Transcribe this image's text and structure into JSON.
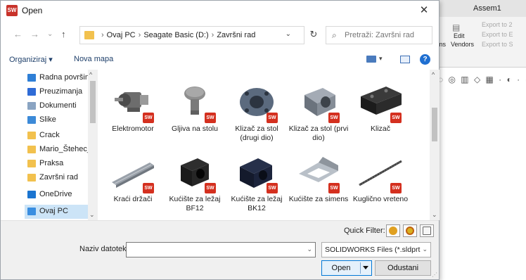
{
  "background_app": {
    "window_title": "Assem1",
    "ribbon": {
      "export_1": "Export to 2",
      "export_2": "Export to E",
      "export_3": "Export to S",
      "edit_label": "Edit",
      "vendors_label": "Vendors",
      "tions_label": "tions",
      "t_label": "t"
    }
  },
  "dialog": {
    "title": "Open",
    "close_glyph": "✕",
    "nav": {
      "back": "←",
      "forward": "→",
      "recent": "⌄",
      "up": "↑"
    },
    "breadcrumb": [
      "Ovaj PC",
      "Seagate Basic (D:)",
      "Završni rad"
    ],
    "breadcrumb_sep": "›",
    "refresh_glyph": "↻",
    "search_placeholder": "Pretraži: Završni rad",
    "toolbar": {
      "organize": "Organiziraj ▾",
      "new_folder": "Nova mapa",
      "help": "?"
    },
    "nav_pane": [
      {
        "label": "Radna površina",
        "pinned": true,
        "color": "#2f7fd6"
      },
      {
        "label": "Preuzimanja",
        "pinned": true,
        "color": "#2f6bd6"
      },
      {
        "label": "Dokumenti",
        "pinned": true,
        "color": "#8aa4c2"
      },
      {
        "label": "Slike",
        "pinned": true,
        "color": "#3c8ad8"
      },
      {
        "label": "Crack",
        "pinned": false,
        "color": "#f2c14e"
      },
      {
        "label": "Mario_Štehec_Al",
        "pinned": false,
        "color": "#f2c14e"
      },
      {
        "label": "Praksa",
        "pinned": false,
        "color": "#f2c14e"
      },
      {
        "label": "Završni rad",
        "pinned": false,
        "color": "#f2c14e"
      },
      {
        "label": "OneDrive",
        "pinned": false,
        "color": "#1b75d0"
      },
      {
        "label": "Ovaj PC",
        "pinned": false,
        "color": "#3a8ee0",
        "selected": true
      }
    ],
    "pin_glyph": "✱",
    "files": [
      {
        "name": "Elektromotor",
        "icon": "motor-part"
      },
      {
        "name": "Gljiva na stolu",
        "icon": "mushroom-part"
      },
      {
        "name": "Klizač za stol (drugi dio)",
        "icon": "flange-part"
      },
      {
        "name": "Klizač za stol (prvi dio)",
        "icon": "block-part"
      },
      {
        "name": "Klizač",
        "icon": "slider-part"
      },
      {
        "name": "Kraći držači",
        "icon": "rod-part"
      },
      {
        "name": "Kućište za ležaj BF12",
        "icon": "bearing-housing-part"
      },
      {
        "name": "Kućište za ležaj BK12",
        "icon": "bearing-housing-blue-part"
      },
      {
        "name": "Kućište za simens",
        "icon": "frame-part"
      },
      {
        "name": "Kuglično vreteno",
        "icon": "ballscrew-part"
      }
    ],
    "sw_badge": "SW",
    "quick_filter_label": "Quick Filter:",
    "file_name_label": "Naziv datoteke:",
    "file_name_value": "",
    "file_type_value": "SOLIDWORKS Files (*.sldprt; *.sl",
    "open_label": "Open",
    "cancel_label": "Odustani"
  }
}
